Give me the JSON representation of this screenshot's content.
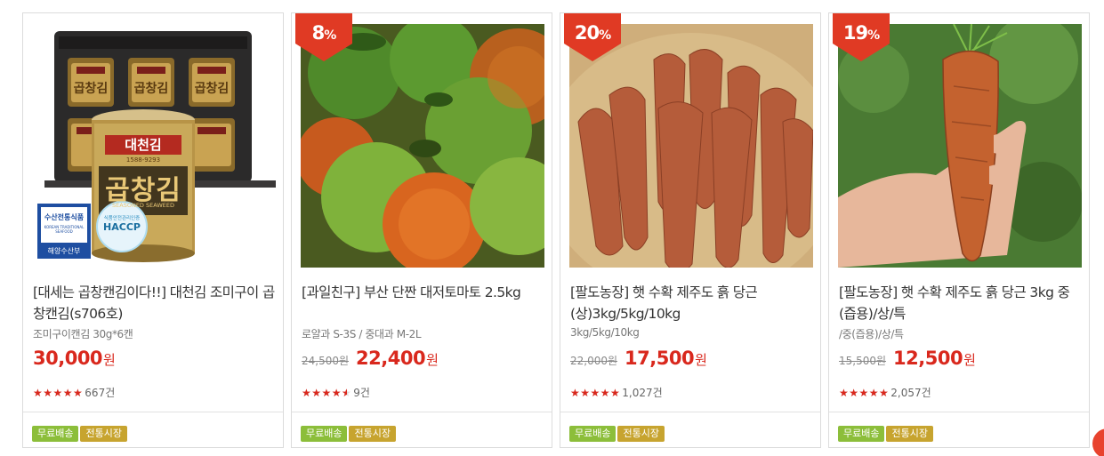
{
  "products": [
    {
      "title": "[대세는 곱창캔김이다!!] 대천김 조미구이 곱창캔김(s706호)",
      "subtitle": "조미구이캔김 30g*6캔",
      "discount": "",
      "original_price": "",
      "price": "30,000",
      "currency": "원",
      "rating": 5,
      "review_count": "667건",
      "tags": [
        "무료배송",
        "전통시장"
      ],
      "image_text": {
        "brand": "대천김",
        "phone": "1588-9293",
        "product": "곱창김",
        "english": "SEASONED SEAWEED",
        "box_label": "곱창김",
        "cert1_title": "수산전통식품",
        "cert1_sub": "KOREAN TRADITIONAL SEAFOOD",
        "cert1_org": "해양수산부",
        "cert2_top": "식품안전관리인증",
        "cert2_main": "HACCP"
      }
    },
    {
      "title": "[과일친구] 부산 단짠 대저토마토 2.5kg",
      "subtitle": "로얄과 S-3S / 중대과 M-2L",
      "discount": "8",
      "original_price": "24,500원",
      "price": "22,400",
      "currency": "원",
      "rating": 4.5,
      "review_count": "9건",
      "tags": [
        "무료배송",
        "전통시장"
      ]
    },
    {
      "title": "[팔도농장] 햇 수확 제주도 흙 당근 (상)3kg/5kg/10kg",
      "subtitle": "3kg/5kg/10kg",
      "discount": "20",
      "original_price": "22,000원",
      "price": "17,500",
      "currency": "원",
      "rating": 5,
      "review_count": "1,027건",
      "tags": [
        "무료배송",
        "전통시장"
      ]
    },
    {
      "title": "[팔도농장] 햇 수확 제주도 흙 당근 3kg 중(즙용)/상/특",
      "subtitle": "/중(즙용)/상/특",
      "discount": "19",
      "original_price": "15,500원",
      "price": "12,500",
      "currency": "원",
      "rating": 5,
      "review_count": "2,057건",
      "tags": [
        "무료배송",
        "전통시장"
      ]
    }
  ],
  "colors": {
    "accent": "#d9281d",
    "tag_green": "#8cbe3a",
    "tag_gold": "#c7a42f"
  },
  "percent_sign": "%",
  "star_glyphs": "★★★★★"
}
